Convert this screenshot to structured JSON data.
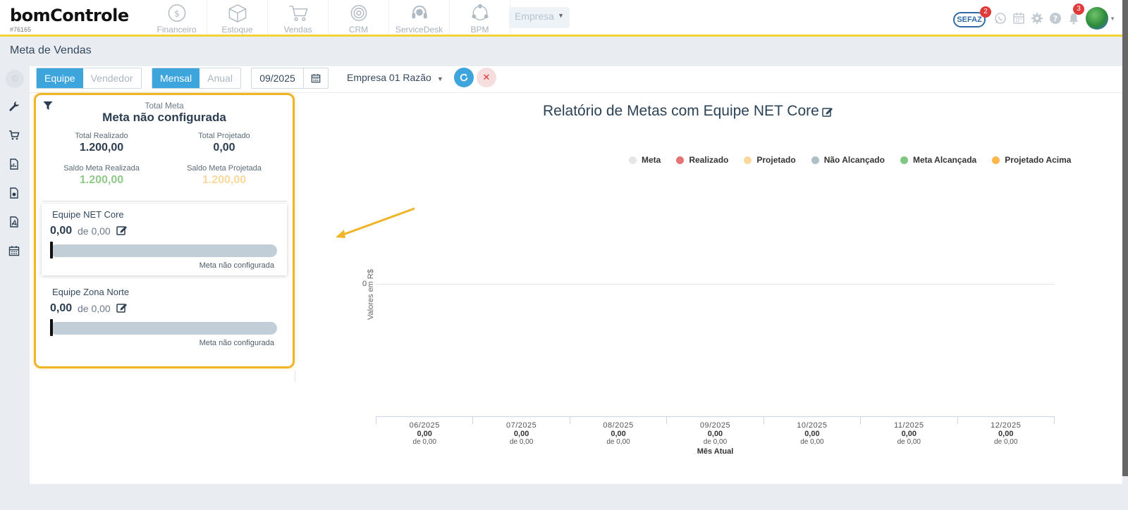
{
  "app": {
    "logo_text": "bomControle",
    "account_id": "#76165"
  },
  "nav": {
    "items": [
      {
        "label": "Financeiro",
        "icon": "coin-icon"
      },
      {
        "label": "Estoque",
        "icon": "box-icon"
      },
      {
        "label": "Vendas",
        "icon": "cart-icon"
      },
      {
        "label": "CRM",
        "icon": "target-icon"
      },
      {
        "label": "ServiceDesk",
        "icon": "headset-icon"
      },
      {
        "label": "BPM",
        "icon": "network-icon"
      }
    ],
    "company_select": "Empresa"
  },
  "top_right": {
    "sefaz_label": "SEFAZ",
    "sefaz_badge": "2",
    "bell_badge": "3"
  },
  "page": {
    "title": "Meta de Vendas"
  },
  "toolbar": {
    "scope": [
      "Equipe",
      "Vendedor"
    ],
    "scope_active": "Equipe",
    "period": [
      "Mensal",
      "Anual"
    ],
    "period_active": "Mensal",
    "date_value": "09/2025",
    "company": "Empresa 01 Razão"
  },
  "summary": {
    "total_meta_label": "Total Meta",
    "total_meta_value": "Meta não configurada",
    "total_realizado_label": "Total Realizado",
    "total_realizado_value": "1.200,00",
    "total_projetado_label": "Total Projetado",
    "total_projetado_value": "0,00",
    "saldo_realizada_label": "Saldo Meta Realizada",
    "saldo_realizada_value": "1.200,00",
    "saldo_projetada_label": "Saldo Meta Projetada",
    "saldo_projetada_value": "1.200,00"
  },
  "teams": [
    {
      "name": "Equipe NET Core",
      "value": "0,00",
      "of": "de 0,00",
      "status": "Meta não configurada",
      "progress": 0
    },
    {
      "name": "Equipe Zona Norte",
      "value": "0,00",
      "of": "de 0,00",
      "status": "Meta não configurada",
      "progress": 0
    }
  ],
  "chart_data": {
    "type": "bar",
    "title": "Relatório de Metas com Equipe NET Core",
    "ylabel": "Valores em R$",
    "yticks": [
      "0"
    ],
    "categories": [
      "06/2025",
      "07/2025",
      "08/2025",
      "09/2025",
      "10/2025",
      "11/2025",
      "12/2025"
    ],
    "values": [
      "0,00",
      "0,00",
      "0,00",
      "0,00",
      "0,00",
      "0,00",
      "0,00"
    ],
    "targets": [
      "de 0,00",
      "de 0,00",
      "de 0,00",
      "de 0,00",
      "de 0,00",
      "de 0,00",
      "de 0,00"
    ],
    "current_month_label": "Mês Atual",
    "current_month_index": 3,
    "legend": [
      {
        "name": "Meta",
        "color": "#e6e6e6"
      },
      {
        "name": "Realizado",
        "color": "#e57373"
      },
      {
        "name": "Projetado",
        "color": "#f8d89c"
      },
      {
        "name": "Não Alcançado",
        "color": "#b0bec5"
      },
      {
        "name": "Meta Alcançada",
        "color": "#81c784"
      },
      {
        "name": "Projetado Acima",
        "color": "#ffb74d"
      }
    ],
    "legend_position": "top-right",
    "grid": true
  },
  "colors": {
    "accent": "#3ea4dc",
    "highlight": "#f0b429",
    "topbar_border": "#f2d434"
  }
}
